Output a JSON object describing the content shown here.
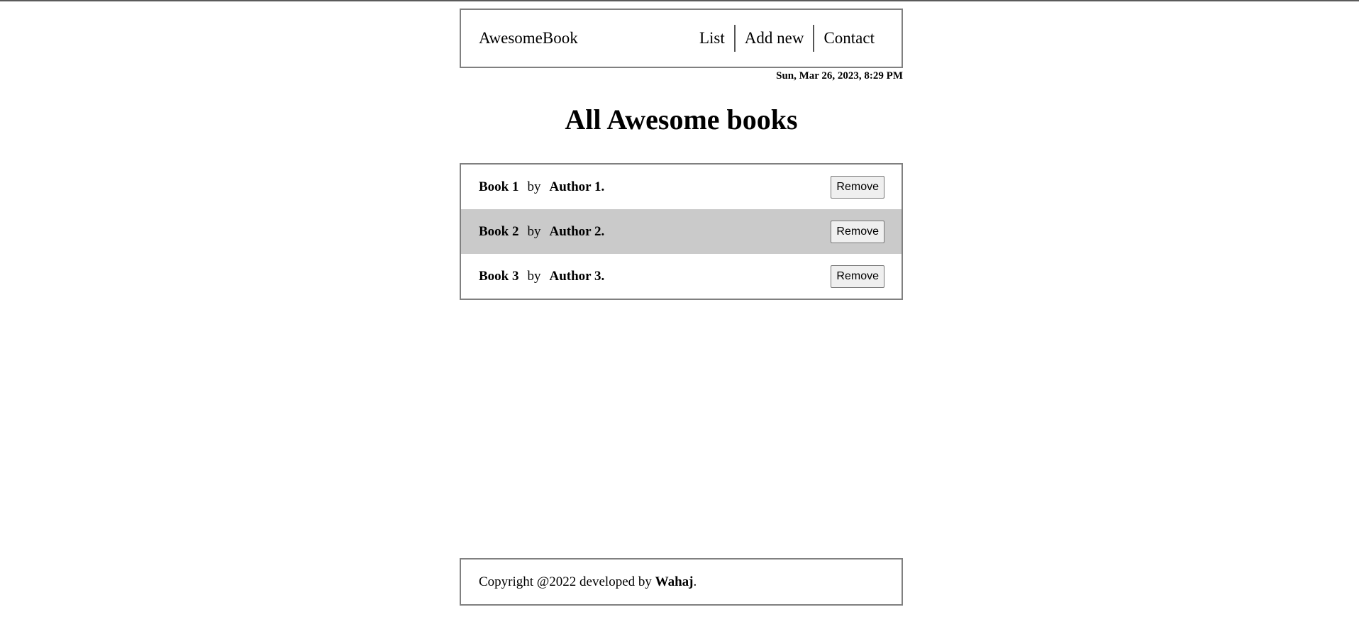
{
  "navbar": {
    "brand": "AwesomeBook",
    "links": [
      "List",
      "Add new",
      "Contact"
    ]
  },
  "datetime": "Sun, Mar 26, 2023, 8:29 PM",
  "page_title": "All Awesome books",
  "books": [
    {
      "title": "Book 1",
      "by": "by",
      "author": "Author 1.",
      "remove_label": "Remove"
    },
    {
      "title": "Book 2",
      "by": "by",
      "author": "Author 2.",
      "remove_label": "Remove"
    },
    {
      "title": "Book 3",
      "by": "by",
      "author": "Author 3.",
      "remove_label": "Remove"
    }
  ],
  "footer": {
    "prefix": "Copyright @2022 developed by ",
    "author": "Wahaj",
    "suffix": "."
  },
  "colors": {
    "alt_row_background": "#cacaca",
    "border": "#808080"
  }
}
